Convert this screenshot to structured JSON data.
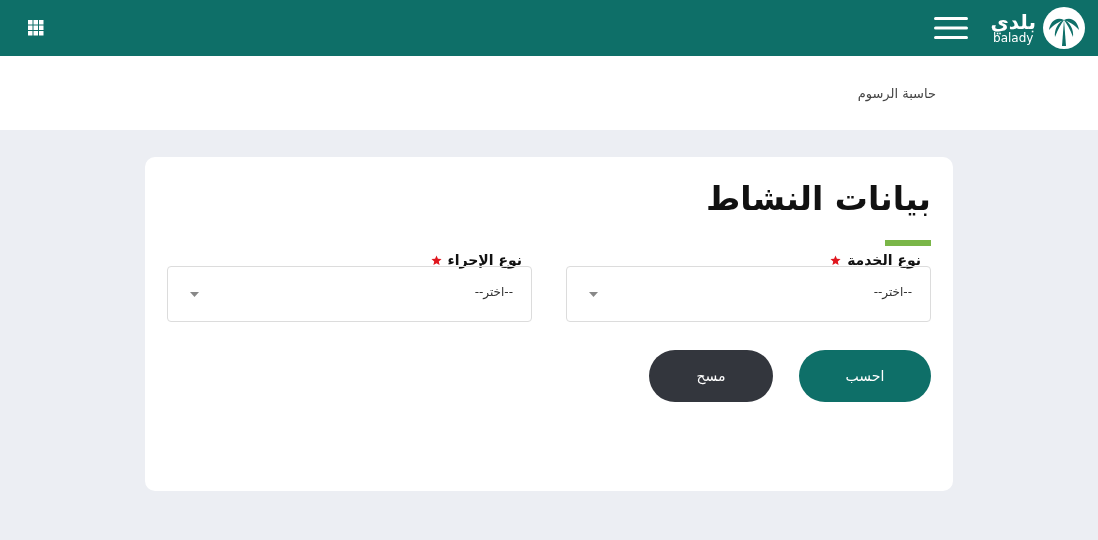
{
  "header": {
    "logo": {
      "arabic": "بلدي",
      "latin": "balady"
    }
  },
  "breadcrumb": "حاسبة الرسوم",
  "form": {
    "title": "بيانات النشاط",
    "fields": [
      {
        "label": "نوع الخدمة",
        "required": true,
        "placeholder": "--اختر--"
      },
      {
        "label": "نوع الإجراء",
        "required": true,
        "placeholder": "--اختر--"
      }
    ],
    "buttons": [
      {
        "label": "احسب",
        "kind": "primary"
      },
      {
        "label": "مسح",
        "kind": "secondary"
      }
    ]
  }
}
